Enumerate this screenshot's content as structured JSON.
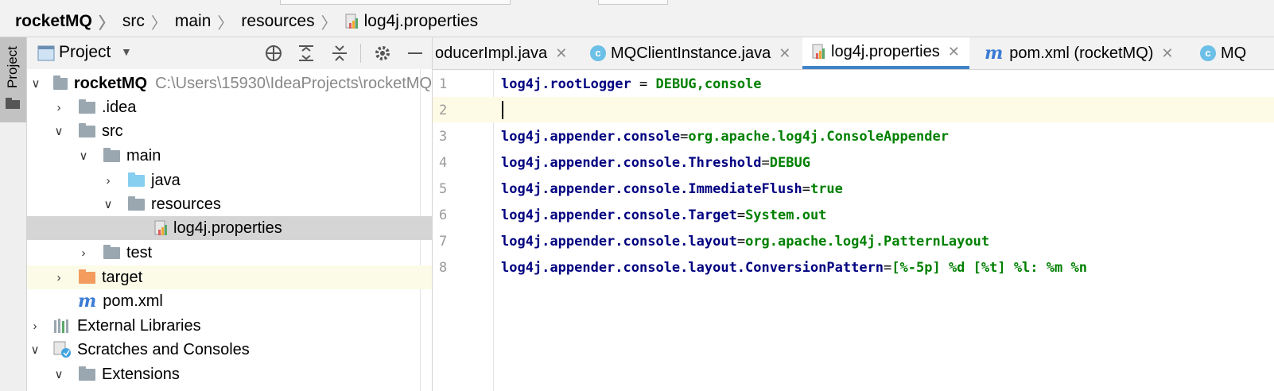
{
  "breadcrumb": [
    "rocketMQ",
    "src",
    "main",
    "resources",
    "log4j.properties"
  ],
  "tool_stripe": {
    "label": "Project"
  },
  "project_panel": {
    "title": "Project",
    "tree": [
      {
        "label": "rocketMQ",
        "path": "C:\\Users\\15930\\IdeaProjects\\rocketMQ",
        "expanded": true
      },
      {
        "label": ".idea",
        "expanded": false
      },
      {
        "label": "src",
        "expanded": true
      },
      {
        "label": "main",
        "expanded": true
      },
      {
        "label": "java",
        "expanded": false
      },
      {
        "label": "resources",
        "expanded": true
      },
      {
        "label": "log4j.properties",
        "selected": true
      },
      {
        "label": "test",
        "expanded": false
      },
      {
        "label": "target",
        "expanded": false
      },
      {
        "label": "pom.xml"
      },
      {
        "label": "External Libraries",
        "expanded": false
      },
      {
        "label": "Scratches and Consoles",
        "expanded": true
      },
      {
        "label": "Extensions",
        "expanded": true
      }
    ]
  },
  "editor_tabs": [
    {
      "label": "oducerImpl.java"
    },
    {
      "label": "MQClientInstance.java"
    },
    {
      "label": "log4j.properties",
      "active": true
    },
    {
      "label": "pom.xml (rocketMQ)"
    },
    {
      "label": "MQ"
    }
  ],
  "editor": {
    "lines": [
      {
        "n": "1",
        "key": "log4j.rootLogger",
        "op": " = ",
        "value": "DEBUG,console"
      },
      {
        "n": "2",
        "key": "",
        "op": "",
        "value": ""
      },
      {
        "n": "3",
        "key": "log4j.appender.console",
        "op": "=",
        "value": "org.apache.log4j.ConsoleAppender"
      },
      {
        "n": "4",
        "key": "log4j.appender.console.Threshold",
        "op": "=",
        "value": "DEBUG"
      },
      {
        "n": "5",
        "key": "log4j.appender.console.ImmediateFlush",
        "op": "=",
        "value": "true"
      },
      {
        "n": "6",
        "key": "log4j.appender.console.Target",
        "op": "=",
        "value": "System.out"
      },
      {
        "n": "7",
        "key": "log4j.appender.console.layout",
        "op": "=",
        "value": "org.apache.log4j.PatternLayout"
      },
      {
        "n": "8",
        "key": "log4j.appender.console.layout.ConversionPattern",
        "op": "=",
        "value": "[%-5p] %d [%t] %l: %m %n"
      }
    ]
  },
  "colors": {
    "key": "#000080",
    "value": "#008000",
    "selection": "#d5d5d5",
    "active_tab_underline": "#4083c9"
  }
}
